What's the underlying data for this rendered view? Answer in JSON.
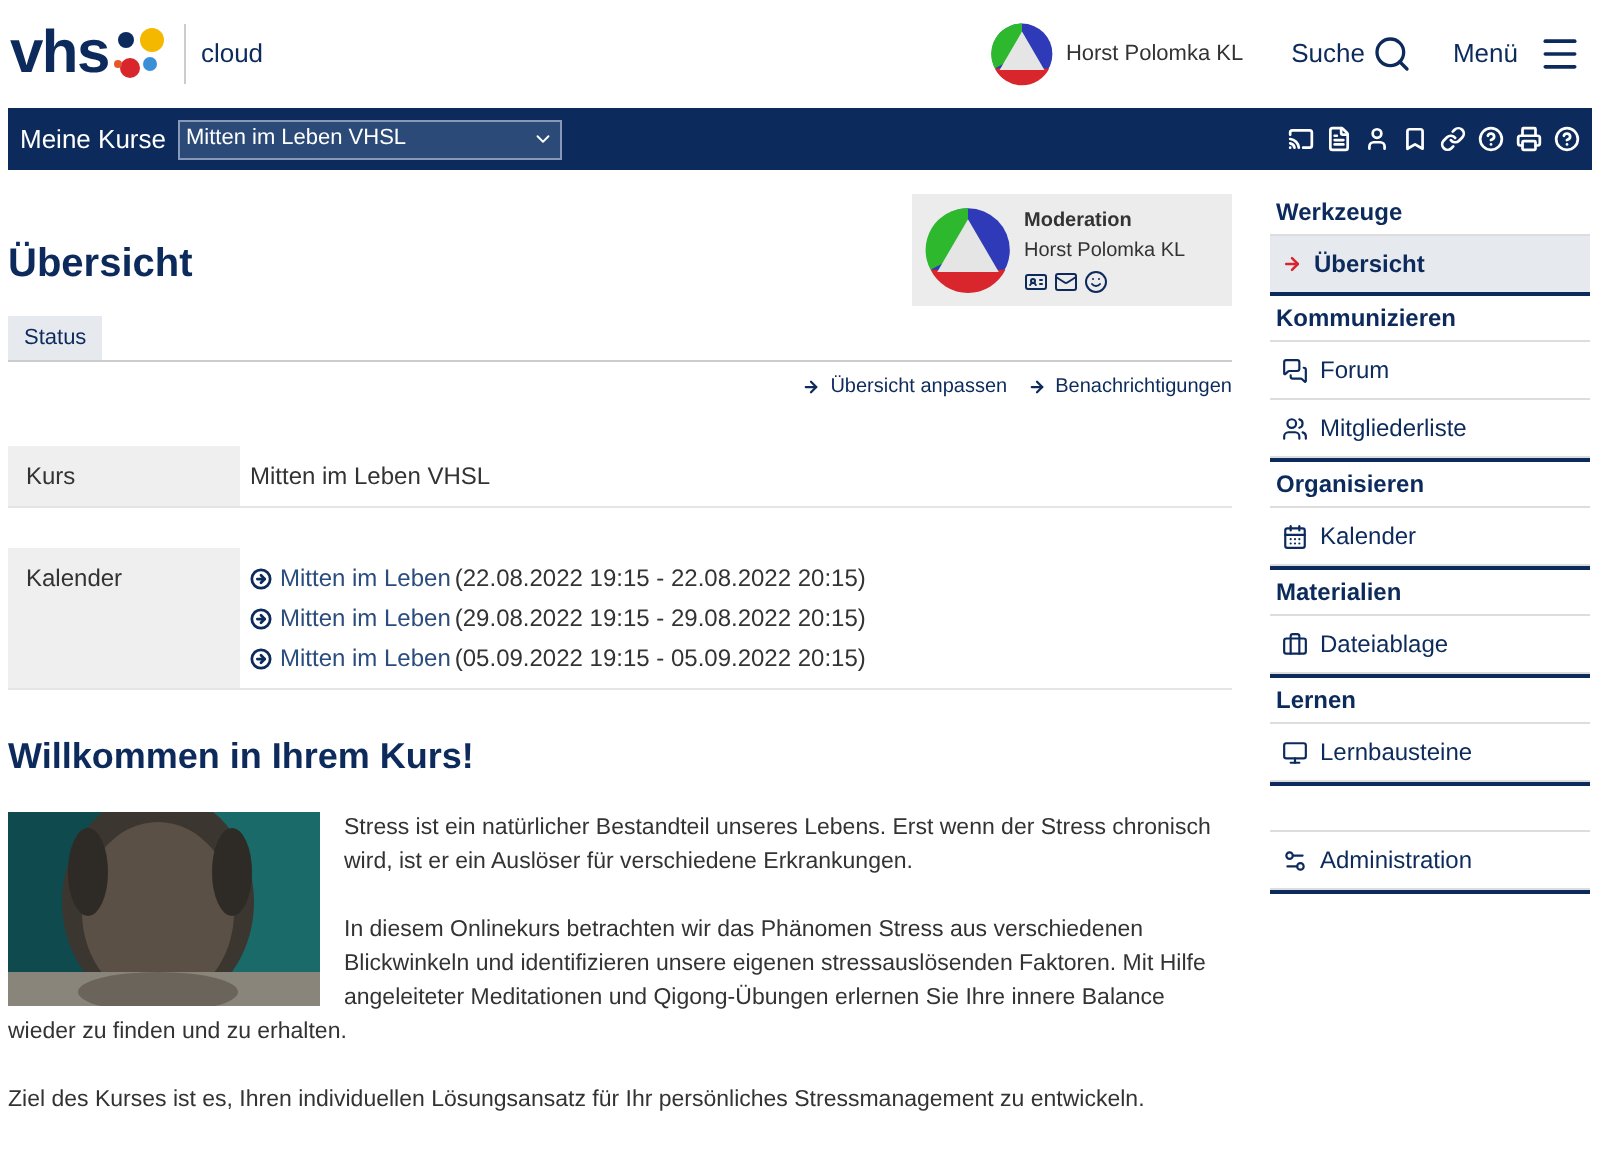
{
  "header": {
    "logo": "vhs",
    "subtitle": "cloud",
    "user": "Horst Polomka KL",
    "search": "Suche",
    "menu": "Menü"
  },
  "navbar": {
    "label": "Meine Kurse",
    "course": "Mitten im Leben VHSL"
  },
  "title": "Übersicht",
  "moderation": {
    "role": "Moderation",
    "name": "Horst Polomka KL"
  },
  "tabs": [
    {
      "label": "Status",
      "selected": true
    }
  ],
  "actions": [
    "Übersicht anpassen",
    "Benachrichtigungen"
  ],
  "info": [
    {
      "label": "Kurs",
      "value": "Mitten im Leben VHSL"
    },
    {
      "label": "Kalender",
      "events": [
        {
          "link": "Mitten im Leben",
          "time": "(22.08.2022 19:15 - 22.08.2022 20:15)"
        },
        {
          "link": "Mitten im Leben",
          "time": "(29.08.2022 19:15 - 29.08.2022 20:15)"
        },
        {
          "link": "Mitten im Leben",
          "time": "(05.09.2022 19:15 - 05.09.2022 20:15)"
        }
      ]
    }
  ],
  "welcome": "Willkommen in Ihrem Kurs!",
  "paragraphs": [
    "Stress ist ein natürlicher Bestandteil unseres Lebens. Erst wenn der Stress chronisch wird, ist er ein Auslöser für verschiedene Erkrankungen.",
    "In diesem Onlinekurs betrachten wir das Phänomen Stress aus verschiedenen Blickwinkeln und identifizieren unsere eigenen stressauslösenden Faktoren. Mit Hilfe angeleiteter Meditationen und Qigong-Übungen erlernen Sie Ihre innere Balance wieder zu finden und zu erhalten.",
    "Ziel des Kurses ist es, Ihren individuellen Lösungsansatz für Ihr persönliches Stressmanagement zu entwickeln."
  ],
  "sidebar": [
    {
      "title": "Werkzeuge",
      "items": [
        {
          "label": "Übersicht",
          "selected": true
        }
      ]
    },
    {
      "title": "Kommunizieren",
      "items": [
        {
          "label": "Forum",
          "selected": false
        },
        {
          "label": "Mitgliederliste",
          "selected": false
        }
      ]
    },
    {
      "title": "Organisieren",
      "items": [
        {
          "label": "Kalender",
          "selected": false
        }
      ]
    },
    {
      "title": "Materialien",
      "items": [
        {
          "label": "Dateiablage",
          "selected": false
        }
      ]
    },
    {
      "title": "Lernen",
      "items": [
        {
          "label": "Lernbausteine",
          "selected": false
        }
      ]
    },
    {
      "items": [
        {
          "label": "Administration",
          "selected": false
        }
      ]
    }
  ]
}
